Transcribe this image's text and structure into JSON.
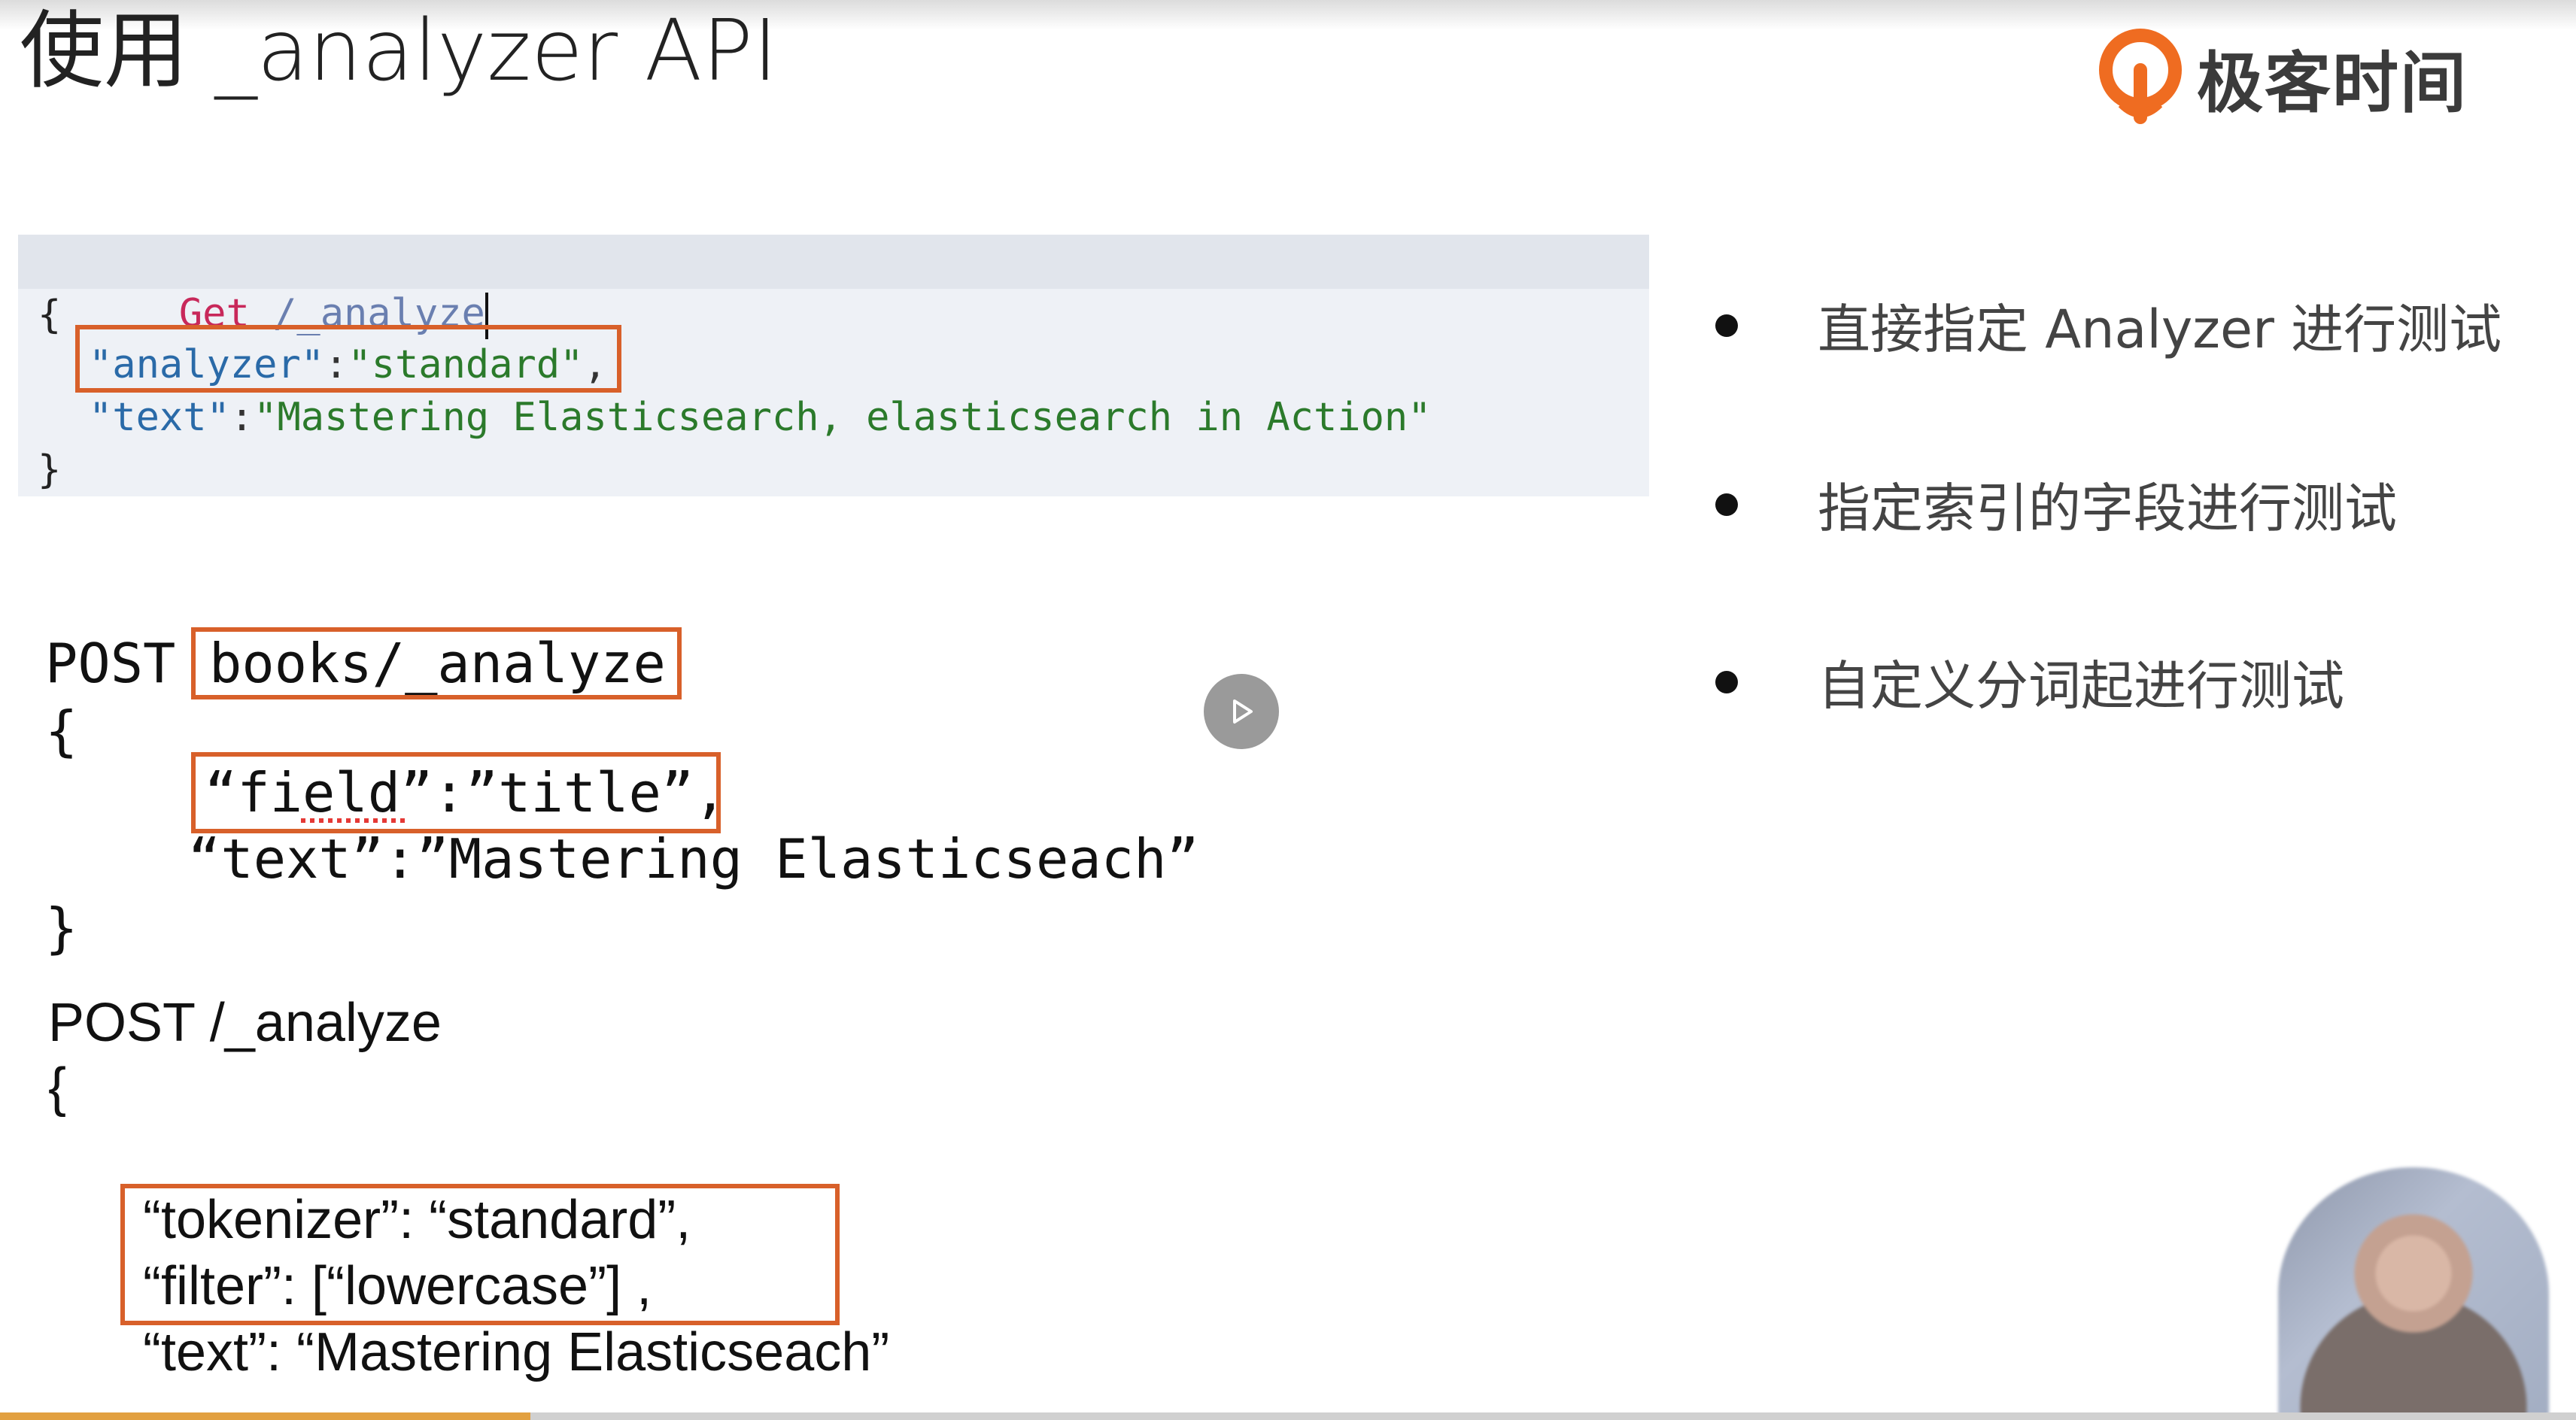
{
  "slide": {
    "title": "使用 _analyzer API",
    "brand": "极客时间"
  },
  "kibana": {
    "method": "Get",
    "path": "/_analyze",
    "open_brace": "{",
    "line1_key": "\"analyzer\"",
    "line1_colon": ":",
    "line1_value": "\"standard\"",
    "line1_comma": ",",
    "line2_key": "\"text\"",
    "line2_colon": ":",
    "line2_value": "\"Mastering Elasticsearch, elasticsearch in Action\"",
    "close_brace": "}"
  },
  "block2": {
    "method": "POST",
    "path": "books/_analyze",
    "open_brace": "{",
    "field_line": "“field”:”title”,",
    "text_line": "“text”:”Mastering Elasticseach”",
    "close_brace": "}"
  },
  "block3": {
    "header": "POST /_analyze",
    "open_brace": "{",
    "tokenizer_line": "“tokenizer”: “standard”,",
    "filter_line": "“filter”: [“lowercase”] ,",
    "text_line": "“text”: “Mastering Elasticseach”"
  },
  "bullets": [
    "直接指定 Analyzer 进行测试",
    "指定索引的字段进行测试",
    "自定义分词起进行测试"
  ],
  "player": {
    "progress_fraction": 0.206
  },
  "colors": {
    "highlight_box": "#d8602a",
    "brand_orange": "#ef6c21"
  },
  "icons": {
    "play": "play-icon",
    "logo": "geektime-logo-icon"
  }
}
